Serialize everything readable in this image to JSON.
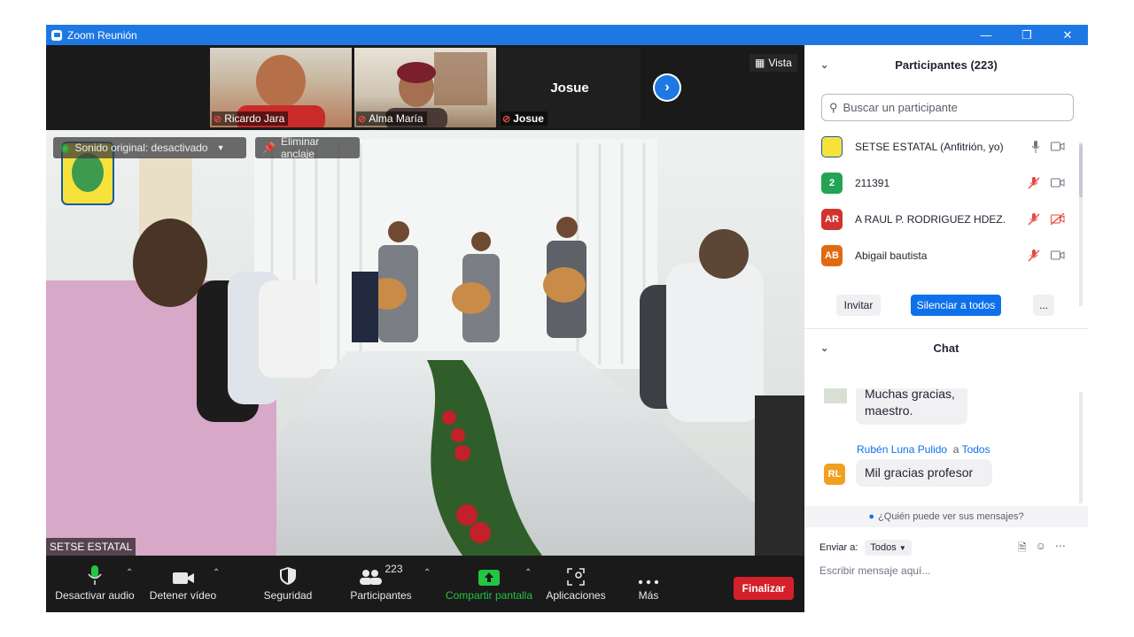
{
  "window": {
    "title": "Zoom Reunión"
  },
  "thumbnails": [
    {
      "name": "Ricardo Jara",
      "muted": true
    },
    {
      "name": "Alma María",
      "muted": true
    },
    {
      "name": "Josue",
      "muted": true,
      "center_label": "Josue"
    }
  ],
  "view_button": {
    "label": "Vista"
  },
  "overlays": {
    "original_sound": "Sonido original: desactivado",
    "unpin": "Eliminar anclaje"
  },
  "active_speaker": "SETSE ESTATAL",
  "toolbar": {
    "mute_label": "Desactivar audio",
    "video_label": "Detener vídeo",
    "security_label": "Seguridad",
    "participants_label": "Participantes",
    "participants_count": "223",
    "share_label": "Compartir pantalla",
    "apps_label": "Aplicaciones",
    "more_label": "Más",
    "end_label": "Finalizar"
  },
  "participants_panel": {
    "header": "Participantes (223)",
    "search_placeholder": "Buscar un participante",
    "rows": [
      {
        "avatar": "",
        "color": "#ffffff",
        "name": "SETSE ESTATAL (Anfitrión, yo)",
        "mic": "on",
        "video": "off"
      },
      {
        "avatar": "2",
        "color": "#23a455",
        "name": "211391",
        "mic": "muted",
        "video": "off"
      },
      {
        "avatar": "AR",
        "color": "#d0342c",
        "name": "A RAUL P. RODRIGUEZ HDEZ.",
        "mic": "muted",
        "video": "stopped"
      },
      {
        "avatar": "AB",
        "color": "#e06a12",
        "name": "Abigail bautista",
        "mic": "muted",
        "video": "off"
      }
    ],
    "invite_label": "Invitar",
    "mute_all_label": "Silenciar a todos",
    "more_label": "..."
  },
  "chat_panel": {
    "header": "Chat",
    "messages": [
      {
        "text_line1": "Muchas gracias,",
        "text_line2": "maestro."
      },
      {
        "sender": "Rubén Luna Pulido",
        "to_word": "a",
        "recipient": "Todos",
        "avatar": "RL",
        "avatar_color": "#f0a020",
        "text": "Mil gracias profesor"
      }
    ],
    "who_can_see": "¿Quién puede ver sus mensajes?",
    "send_to_label": "Enviar a:",
    "send_to_value": "Todos",
    "input_placeholder": "Escribir mensaje aquí..."
  },
  "colors": {
    "zoom_blue": "#1e78e4",
    "end_red": "#d3202a",
    "share_green": "#23c542"
  }
}
